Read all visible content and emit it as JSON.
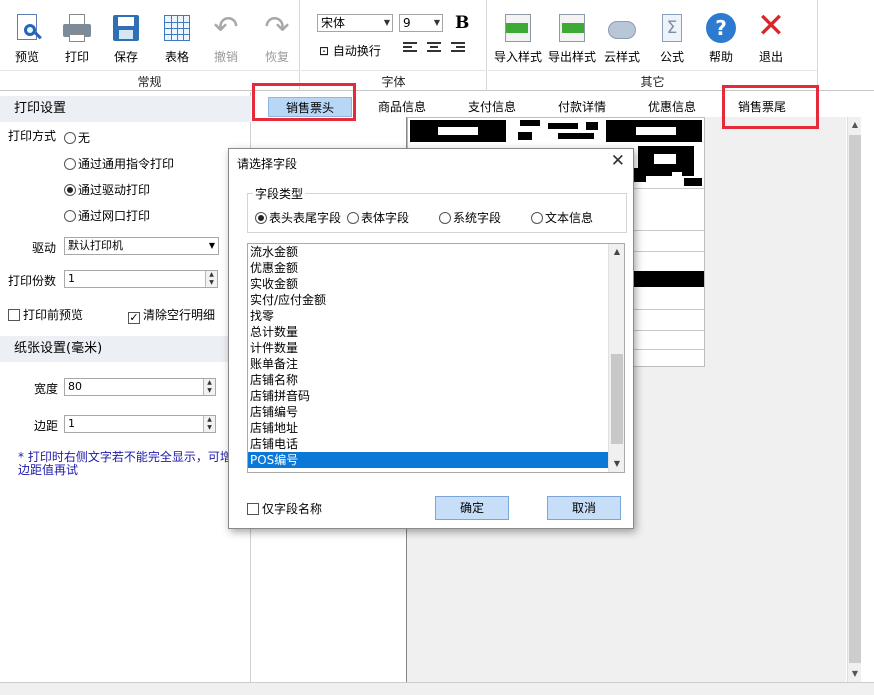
{
  "ribbon": {
    "groups": {
      "general": "常规",
      "font": "字体",
      "other": "其它"
    },
    "buttons": {
      "preview": "预览",
      "print": "打印",
      "save": "保存",
      "table": "表格",
      "undo": "撤销",
      "redo": "恢复",
      "import_style": "导入样式",
      "export_style": "导出样式",
      "cloud_style": "云样式",
      "formula": "公式",
      "help": "帮助",
      "exit": "退出"
    },
    "font_name": "宋体",
    "font_size": "9",
    "bold": "B",
    "auto_wrap": "自动换行"
  },
  "left_panel": {
    "print_settings": "打印设置",
    "print_mode_label": "打印方式",
    "modes": [
      "无",
      "通过通用指令打印",
      "通过驱动打印",
      "通过网口打印"
    ],
    "selected_mode": 2,
    "driver_label": "驱动",
    "driver_value": "默认打印机",
    "copies_label": "打印份数",
    "copies_value": "1",
    "preview_before_print": "打印前预览",
    "clear_empty_rows": "清除空行明细",
    "paper_settings": "纸张设置(毫米)",
    "width_label": "宽度",
    "width_value": "80",
    "margin_label": "边距",
    "margin_value": "1",
    "note": "* 打印时右侧文字若不能完全显示，可增大边距值再试"
  },
  "tabs": [
    "销售票头",
    "商品信息",
    "支付信息",
    "付款详情",
    "优惠信息",
    "销售票尾"
  ],
  "active_tab": "销售票头",
  "dialog": {
    "title": "请选择字段",
    "close": "✕",
    "field_type_legend": "字段类型",
    "types": [
      "表头表尾字段",
      "表体字段",
      "系统字段",
      "文本信息"
    ],
    "selected_type": 0,
    "fields": [
      "流水金额",
      "优惠金额",
      "实收金额",
      "实付/应付金额",
      "找零",
      "总计数量",
      "计件数量",
      "账单备注",
      "店铺名称",
      "店铺拼音码",
      "店铺编号",
      "店铺地址",
      "店铺电话",
      "POS编号"
    ],
    "selected_field": "POS编号",
    "field_name_only": "仅字段名称",
    "ok": "确定",
    "cancel": "取消"
  },
  "colors": {
    "highlight": "#e62a3a",
    "selection": "#0b78d7",
    "tab_active": "#b8d6f6"
  }
}
